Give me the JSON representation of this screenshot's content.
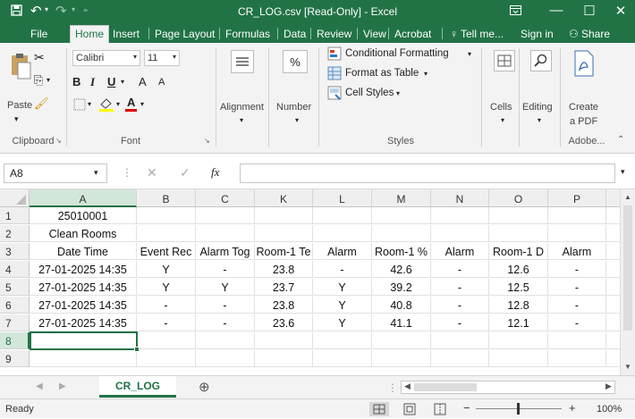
{
  "window": {
    "title": "CR_LOG.csv  [Read-Only] - Excel"
  },
  "menu": {
    "tabs": [
      "File",
      "Home",
      "Insert",
      "Page Layout",
      "Formulas",
      "Data",
      "Review",
      "View",
      "Acrobat"
    ],
    "tell_me": "Tell me...",
    "sign_in": "Sign in",
    "share": "Share"
  },
  "ribbon": {
    "paste": "Paste",
    "clipboard": "Clipboard",
    "font_name": "Calibri",
    "font_size": "11",
    "font": "Font",
    "alignment": "Alignment",
    "number": "Number",
    "percent": "%",
    "conditional_formatting": "Conditional Formatting",
    "format_as_table": "Format as Table",
    "cell_styles": "Cell Styles",
    "styles": "Styles",
    "cells": "Cells",
    "editing": "Editing",
    "create_pdf_1": "Create",
    "create_pdf_2": "a PDF",
    "adobe": "Adobe...",
    "bold": "B",
    "italic": "I",
    "underline": "U",
    "font_grow": "A",
    "font_shrink": "A",
    "font_color": "A"
  },
  "formula_bar": {
    "name_box": "A8",
    "fx": "fx",
    "value": ""
  },
  "columns": [
    "A",
    "B",
    "C",
    "K",
    "L",
    "M",
    "N",
    "O",
    "P"
  ],
  "rows": [
    "1",
    "2",
    "3",
    "4",
    "5",
    "6",
    "7",
    "8",
    "9"
  ],
  "cells": [
    [
      "25010001",
      "",
      "",
      "",
      "",
      "",
      "",
      "",
      ""
    ],
    [
      "Clean Rooms",
      "",
      "",
      "",
      "",
      "",
      "",
      "",
      ""
    ],
    [
      "Date Time",
      "Event Rec",
      "Alarm Tog",
      "Room-1 Te",
      "Alarm",
      "Room-1 %",
      "Alarm",
      "Room-1 D",
      "Alarm"
    ],
    [
      "27-01-2025 14:35",
      "Y",
      "-",
      "23.8",
      "-",
      "42.6",
      "-",
      "12.6",
      "-"
    ],
    [
      "27-01-2025 14:35",
      "Y",
      "Y",
      "23.7",
      "Y",
      "39.2",
      "-",
      "12.5",
      "-"
    ],
    [
      "27-01-2025 14:35",
      "-",
      "-",
      "23.8",
      "Y",
      "40.8",
      "-",
      "12.8",
      "-"
    ],
    [
      "27-01-2025 14:35",
      "-",
      "-",
      "23.6",
      "Y",
      "41.1",
      "-",
      "12.1",
      "-"
    ],
    [
      "",
      "",
      "",
      "",
      "",
      "",
      "",
      "",
      ""
    ],
    [
      "",
      "",
      "",
      "",
      "",
      "",
      "",
      "",
      ""
    ]
  ],
  "sheet": {
    "tab": "CR_LOG",
    "add": "⊕"
  },
  "status": {
    "ready": "Ready",
    "zoom": "100%"
  }
}
